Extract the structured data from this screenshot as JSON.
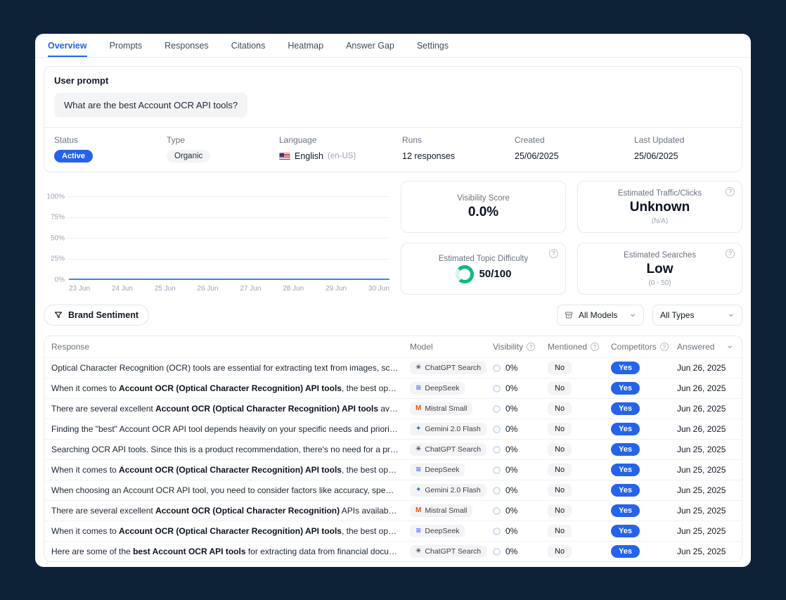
{
  "tabs": [
    {
      "label": "Overview",
      "active": true
    },
    {
      "label": "Prompts",
      "active": false
    },
    {
      "label": "Responses",
      "active": false
    },
    {
      "label": "Citations",
      "active": false
    },
    {
      "label": "Heatmap",
      "active": false
    },
    {
      "label": "Answer Gap",
      "active": false
    },
    {
      "label": "Settings",
      "active": false
    }
  ],
  "prompt_panel": {
    "label": "User prompt",
    "prompt": "What are the best Account OCR API tools?"
  },
  "meta": {
    "fields": [
      {
        "label": "Status",
        "type": "badge",
        "value": "Active"
      },
      {
        "label": "Type",
        "type": "chip",
        "value": "Organic"
      },
      {
        "label": "Language",
        "type": "language",
        "value": "English",
        "detail": "(en-US)",
        "icon": "us-flag-icon"
      },
      {
        "label": "Runs",
        "type": "text",
        "value": "12 responses"
      },
      {
        "label": "Created",
        "type": "text",
        "value": "25/06/2025"
      },
      {
        "label": "Last Updated",
        "type": "text",
        "value": "25/06/2025"
      }
    ]
  },
  "chart_data": {
    "type": "line",
    "title": "Visibility over time",
    "x": [
      "23 Jun",
      "24 Jun",
      "25 Jun",
      "26 Jun",
      "27 Jun",
      "28 Jun",
      "29 Jun",
      "30 Jun"
    ],
    "series": [
      {
        "name": "Visibility",
        "values": [
          0,
          0,
          0,
          0,
          0,
          0,
          0,
          0
        ]
      }
    ],
    "y_ticks": [
      "100%",
      "75%",
      "50%",
      "25%",
      "0%"
    ],
    "ylim": [
      0,
      100
    ],
    "grid": true,
    "legend": "none",
    "line_color": "#3b82f6"
  },
  "stat_cards": [
    {
      "title": "Visibility Score",
      "value": "0.0%",
      "help": false
    },
    {
      "title": "Estimated Traffic/Clicks",
      "value": "Unknown",
      "sub": "(N/A)",
      "help": true
    },
    {
      "title": "Estimated Topic Difficulty",
      "value": "50/100",
      "gauge": 50,
      "help": true
    },
    {
      "title": "Estimated Searches",
      "value": "Low",
      "sub": "(0 - 50)",
      "help": true
    }
  ],
  "filters": {
    "brand_sentiment_label": "Brand Sentiment",
    "models_dropdown": "All Models",
    "types_dropdown": "All Types"
  },
  "table": {
    "columns": [
      {
        "label": "Response",
        "help": false,
        "sortable": false
      },
      {
        "label": "Model",
        "help": false,
        "sortable": false
      },
      {
        "label": "Visibility",
        "help": true,
        "sortable": false
      },
      {
        "label": "Mentioned",
        "help": true,
        "sortable": false
      },
      {
        "label": "Competitors",
        "help": true,
        "sortable": false
      },
      {
        "label": "Answered",
        "help": false,
        "sortable": true
      }
    ],
    "rows": [
      {
        "response": [
          {
            "t": "Optical Character Recognition (OCR) tools are essential for extracting text from images, scanned documents, ..."
          }
        ],
        "model": "ChatGPT Search",
        "model_icon": "openai",
        "visibility": "0%",
        "mentioned": "No",
        "competitors": "Yes",
        "answered": "Jun 26, 2025"
      },
      {
        "response": [
          {
            "t": "When it comes to "
          },
          {
            "t": "Account OCR (Optical Character Recognition) API tools",
            "b": true
          },
          {
            "t": ", the best options depend on you..."
          }
        ],
        "model": "DeepSeek",
        "model_icon": "deepseek",
        "visibility": "0%",
        "mentioned": "No",
        "competitors": "Yes",
        "answered": "Jun 26, 2025"
      },
      {
        "response": [
          {
            "t": "There are several excellent "
          },
          {
            "t": "Account OCR (Optical Character Recognition) API tools",
            "b": true
          },
          {
            "t": " available, depending on..."
          }
        ],
        "model": "Mistral Small",
        "model_icon": "mistral",
        "visibility": "0%",
        "mentioned": "No",
        "competitors": "Yes",
        "answered": "Jun 26, 2025"
      },
      {
        "response": [
          {
            "t": "Finding the \"best\" Account OCR API tool depends heavily on your specific needs and priorities. Here's a breakd..."
          }
        ],
        "model": "Gemini 2.0 Flash",
        "model_icon": "gemini",
        "visibility": "0%",
        "mentioned": "No",
        "competitors": "Yes",
        "answered": "Jun 26, 2025"
      },
      {
        "response": [
          {
            "t": "Searching OCR API tools. Since this is a product recommendation, there's no need for a product query. I'll just l..."
          }
        ],
        "model": "ChatGPT Search",
        "model_icon": "openai",
        "visibility": "0%",
        "mentioned": "No",
        "competitors": "Yes",
        "answered": "Jun 25, 2025"
      },
      {
        "response": [
          {
            "t": "When it comes to "
          },
          {
            "t": "Account OCR (Optical Character Recognition) API tools",
            "b": true
          },
          {
            "t": ", the best options depend on you..."
          }
        ],
        "model": "DeepSeek",
        "model_icon": "deepseek",
        "visibility": "0%",
        "mentioned": "No",
        "competitors": "Yes",
        "answered": "Jun 25, 2025"
      },
      {
        "response": [
          {
            "t": "When choosing an Account OCR API tool, you need to consider factors like accuracy, speed, pricing, ease of in..."
          }
        ],
        "model": "Gemini 2.0 Flash",
        "model_icon": "gemini",
        "visibility": "0%",
        "mentioned": "No",
        "competitors": "Yes",
        "answered": "Jun 25, 2025"
      },
      {
        "response": [
          {
            "t": "There are several excellent "
          },
          {
            "t": "Account OCR (Optical Character Recognition)",
            "b": true
          },
          {
            "t": " APIs available, depending on your..."
          }
        ],
        "model": "Mistral Small",
        "model_icon": "mistral",
        "visibility": "0%",
        "mentioned": "No",
        "competitors": "Yes",
        "answered": "Jun 25, 2025"
      },
      {
        "response": [
          {
            "t": "When it comes to "
          },
          {
            "t": "Account OCR (Optical Character Recognition) API tools",
            "b": true
          },
          {
            "t": ", the best options depend on you..."
          }
        ],
        "model": "DeepSeek",
        "model_icon": "deepseek",
        "visibility": "0%",
        "mentioned": "No",
        "competitors": "Yes",
        "answered": "Jun 25, 2025"
      },
      {
        "response": [
          {
            "t": "Here are some of the "
          },
          {
            "t": "best Account OCR API tools",
            "b": true
          },
          {
            "t": " for extracting data from financial documents like invoices,..."
          }
        ],
        "model": "ChatGPT Search",
        "model_icon": "openai",
        "visibility": "0%",
        "mentioned": "No",
        "competitors": "Yes",
        "answered": "Jun 25, 2025"
      }
    ]
  }
}
